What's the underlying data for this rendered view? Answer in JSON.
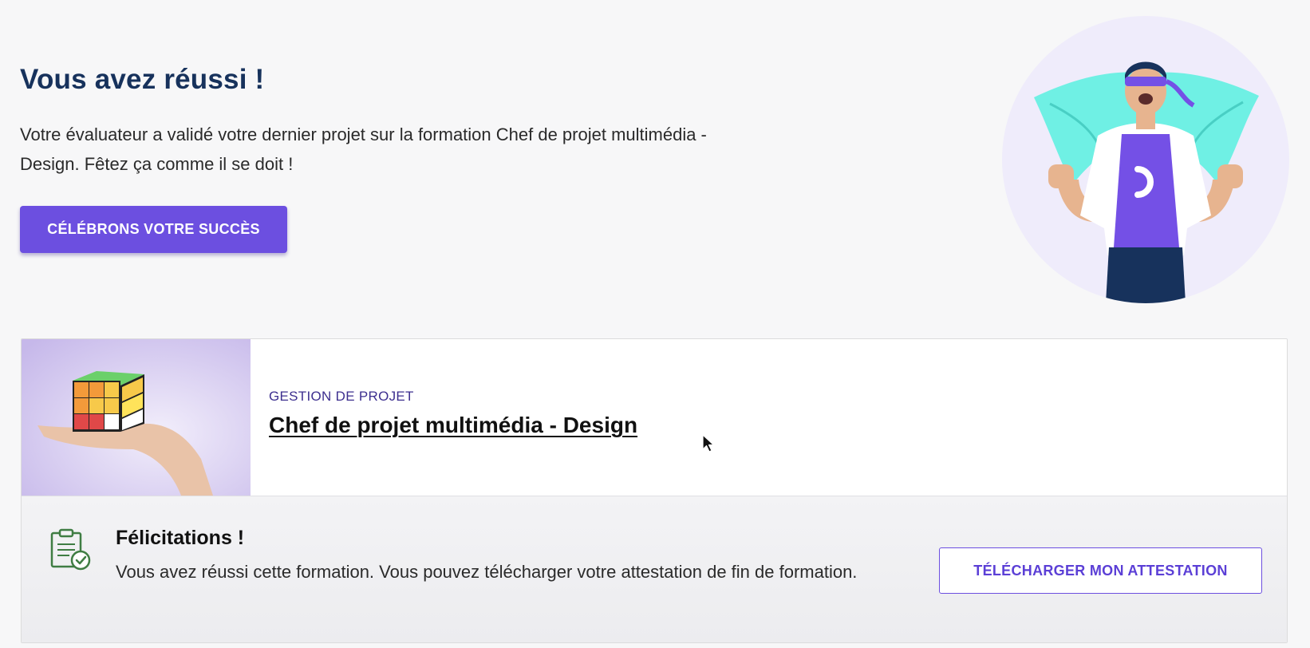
{
  "hero": {
    "title": "Vous avez réussi !",
    "text": "Votre évaluateur a validé votre dernier projet sur la formation Chef de projet multimédia - Design. Fêtez ça comme il se doit !",
    "cta_label": "CÉLÉBRONS VOTRE SUCCÈS",
    "illustration": "superhero-celebration-illustration"
  },
  "course": {
    "category": "GESTION DE PROJET",
    "title": "Chef de projet multimédia - Design",
    "thumbnail": "rubiks-cube-on-hand-image"
  },
  "completion": {
    "title": "Félicitations !",
    "text": "Vous avez réussi cette formation. Vous pouvez télécharger votre attestation de fin de formation.",
    "download_label": "TÉLÉCHARGER MON ATTESTATION",
    "icon": "certificate-clipboard-check-icon"
  },
  "colors": {
    "accent": "#6c4fe0",
    "title": "#17325c",
    "category": "#3d2f8f"
  }
}
